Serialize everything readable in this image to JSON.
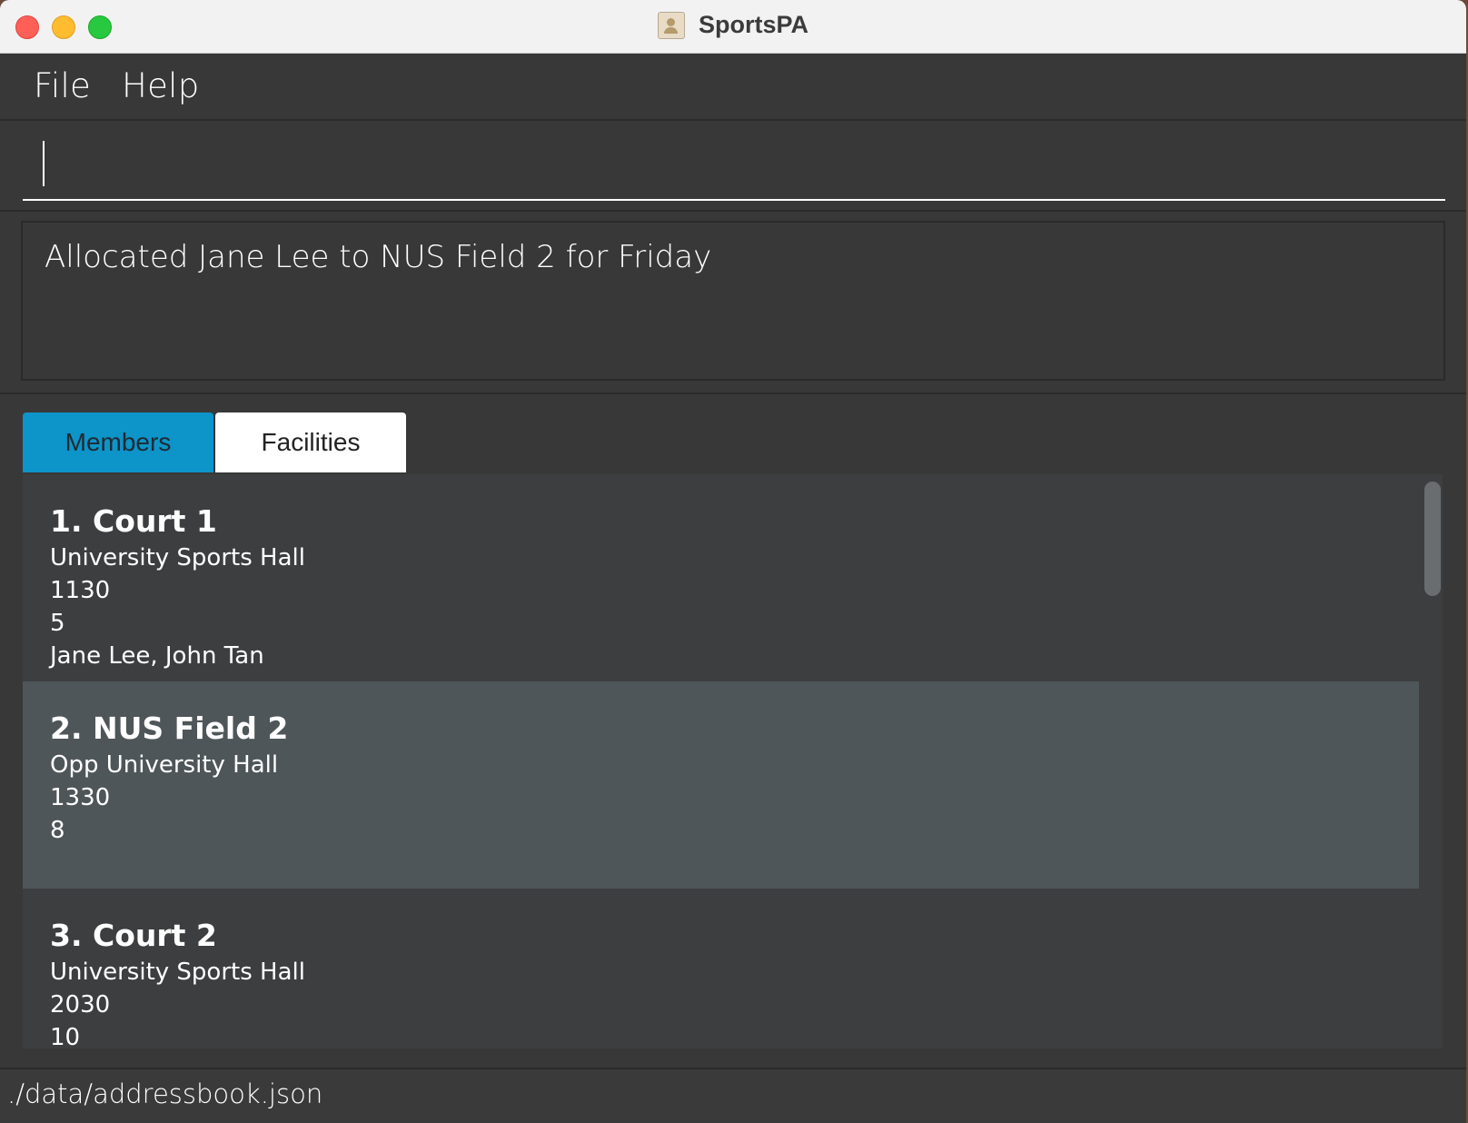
{
  "window": {
    "title": "SportsPA"
  },
  "menu": {
    "items": [
      {
        "label": "File"
      },
      {
        "label": "Help"
      }
    ]
  },
  "command": {
    "value": "",
    "placeholder": ""
  },
  "result": {
    "message": "Allocated Jane Lee to NUS Field 2 for Friday"
  },
  "tabs": [
    {
      "label": "Members",
      "selected": true
    },
    {
      "label": "Facilities",
      "selected": false
    }
  ],
  "facilities": [
    {
      "name": "1. Court 1",
      "location": "University Sports Hall",
      "time": "1130",
      "capacity": "5",
      "members": "Jane Lee, John Tan"
    },
    {
      "name": "2. NUS Field 2",
      "location": "Opp University Hall",
      "time": "1330",
      "capacity": "8",
      "members": ""
    },
    {
      "name": "3. Court 2",
      "location": "University Sports Hall",
      "time": "2030",
      "capacity": "10",
      "members": ""
    }
  ],
  "status": {
    "path": "./data/addressbook.json"
  },
  "colors": {
    "tab_selected": "#0d94c8",
    "background": "#383838",
    "list_item": "#3c3e3f",
    "list_item_alt": "#4f5659"
  }
}
